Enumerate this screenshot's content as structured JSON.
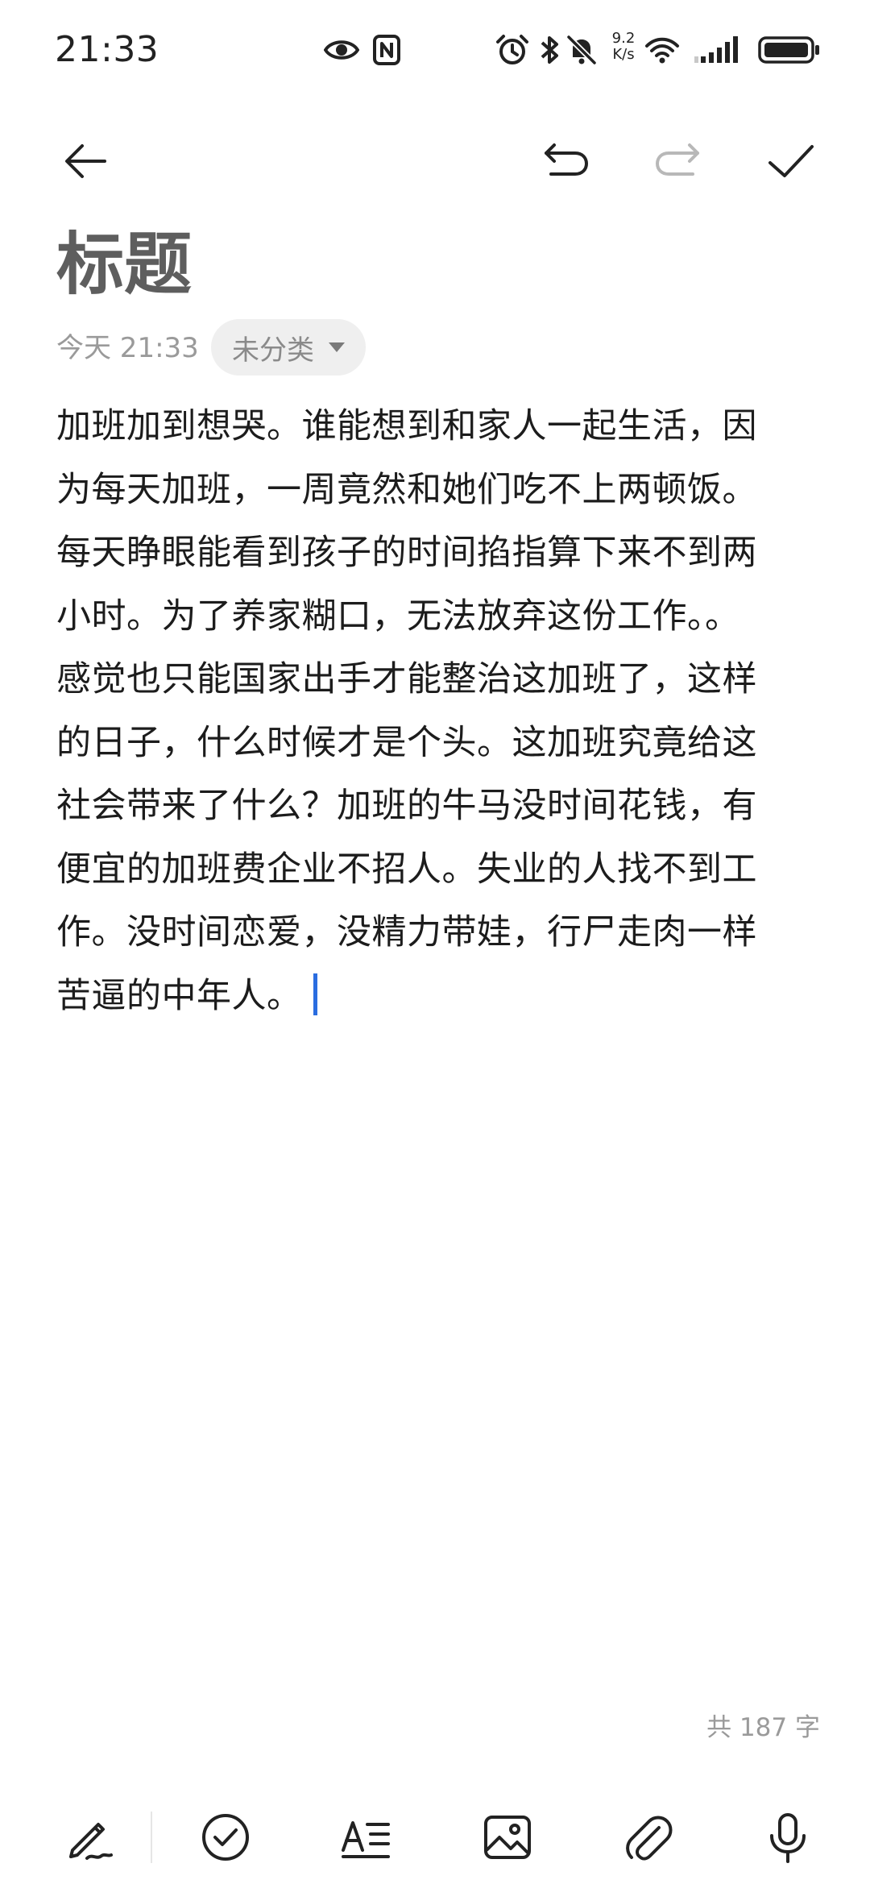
{
  "status_bar": {
    "time": "21:33",
    "net_speed_value": "9.2",
    "net_speed_unit": "K/s",
    "icons": [
      "eye-icon",
      "nfc-icon",
      "alarm-icon",
      "bluetooth-icon",
      "mute-icon",
      "wifi-icon",
      "signal-icon",
      "battery-icon"
    ]
  },
  "toolbar": {
    "icons": [
      "back-arrow-icon",
      "undo-icon",
      "redo-icon",
      "check-icon"
    ]
  },
  "note": {
    "title": "标题",
    "date": "今天 21:33",
    "category": "未分类",
    "lines": [
      "加班加到想哭。谁能想到和家人一起生活，因",
      "为每天加班，一周竟然和她们吃不上两顿饭。",
      "每天睁眼能看到孩子的时间掐指算下来不到两",
      "小时。为了养家糊口，无法放弃这份工作。。",
      "感觉也只能国家出手才能整治这加班了，这样",
      "的日子，什么时候才是个头。这加班究竟给这",
      "社会带来了什么？加班的牛马没时间花钱，有",
      "便宜的加班费企业不招人。失业的人找不到工",
      "作。没时间恋爱，没精力带娃，行尸走肉一样",
      "苦逼的中年人。"
    ],
    "word_count": "共 187 字"
  },
  "bottom_toolbar": {
    "icons": [
      "handwriting-icon",
      "checklist-icon",
      "text-format-icon",
      "image-icon",
      "attachment-icon",
      "microphone-icon"
    ]
  },
  "colors": {
    "accent_cursor": "#2a6de0",
    "title": "#5e5e5e",
    "meta": "#9a9a9a",
    "chip_bg": "#efefef",
    "redo_disabled": "#b8b8b8"
  }
}
